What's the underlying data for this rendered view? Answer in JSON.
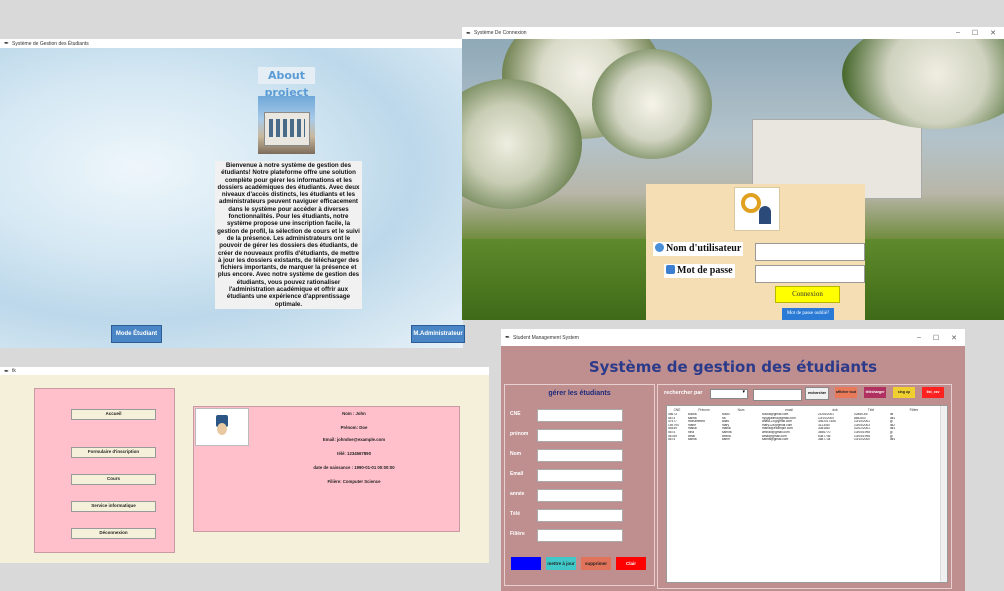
{
  "about_window": {
    "title": "Système de Gestion des Étudiants",
    "heading": "About project",
    "description": "Bienvenue à notre système de gestion des étudiants! Notre plateforme offre une solution complète pour gérer les informations et les dossiers académiques des étudiants. Avec deux niveaux d'accès distincts, les étudiants et les administrateurs peuvent naviguer efficacement dans le système pour accéder à diverses fonctionnalités. Pour les étudiants, notre système propose une inscription facile, la gestion de profil, la sélection de cours et le suivi de la présence. Les administrateurs ont le pouvoir de gérer les dossiers des étudiants, de créer de nouveaux profils d'étudiants, de mettre à jour les dossiers existants, de télécharger des fichiers importants, de marquer la présence et plus encore. Avec notre système de gestion des étudiants, vous pouvez rationaliser l'administration académique et offrir aux étudiants une expérience d'apprentissage optimale.",
    "btn_student": "Mode Étudiant",
    "btn_admin": "M.Administrateur"
  },
  "login_window": {
    "title": "Système De Connexion",
    "username_label": "Nom d'utilisateur",
    "password_label": "Mot de passe",
    "username_value": "",
    "password_value": "",
    "connect_button": "Connexion",
    "forgot_button": "Mot de passe oublié?"
  },
  "profile_window": {
    "title": "tk",
    "menu": [
      "Accueil",
      "Formulaire d'inscription",
      "Cours",
      "Service informatique",
      "Déconnexion"
    ],
    "lines": [
      "Nom : John",
      "Prénom: Doe",
      "Email: johndoe@example.com",
      "télé: 1234567890",
      "date de naissance : 1990-01-01 00:00:00",
      "Filière: Computer Science"
    ]
  },
  "management_window": {
    "title": "Student Management System",
    "heading": "Système de gestion des étudiants",
    "form_title": "gérer les étudiants",
    "form_labels": [
      "CNE",
      "prénom",
      "Nom",
      "Email",
      "année",
      "Télé",
      "Filière"
    ],
    "form_buttons": [
      "",
      "mettre à jour",
      "supprimer",
      "Clair"
    ],
    "search_label": "rechercher par",
    "search_buttons": [
      "rechercher",
      "afficher tout",
      "télécharger",
      "sing up",
      "list_csv"
    ],
    "table_headers": [
      "CNE",
      "Prénom",
      "Nom",
      "email",
      "dob",
      "Télé",
      "Filière"
    ],
    "rows": [
      [
        "45673",
        "souka",
        "souki",
        "souka@gmail.com",
        "21/06/2001",
        "02865-65",
        "ist"
      ],
      [
        "5674",
        "salma",
        "ha",
        "hyyygaiima@gmail.com",
        "10/10/2000",
        "8652647",
        "iaf1"
      ],
      [
        "47577",
        "mohammed",
        "anas",
        "anas123@gmail.com",
        "3/8/2017456",
        "10/10/2001",
        "gi"
      ],
      [
        "159794",
        "marie",
        "mary",
        "mary124@gmail.com",
        "3123487",
        "10/05/2003",
        "iid2"
      ],
      [
        "54549",
        "manal",
        "manal",
        "manal@example.com",
        "3081887",
        "02/02/2001",
        "iaf1"
      ],
      [
        "5674",
        "nina",
        "samira",
        "amirad@gmail.com",
        "3656770",
        "10/05/1998",
        "gi"
      ],
      [
        "56789",
        "amal",
        "amina",
        "amal@gmail.com",
        "6387746",
        "10/05/1998",
        "gi"
      ],
      [
        "5674",
        "salma",
        "karim",
        "salma@gmail.com",
        "3687734",
        "10/10/2000",
        "iaf1"
      ]
    ]
  },
  "colors": {
    "accent_blue": "#4a86c5",
    "login_panel": "#f5deb3",
    "profile_pink": "#ffc0cb",
    "management_bg": "#bf8f8f",
    "title_blue": "#2b3a8a"
  }
}
